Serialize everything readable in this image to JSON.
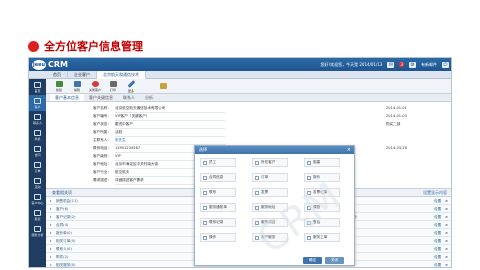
{
  "slide": {
    "title": "全方位客户信息管理"
  },
  "app": {
    "logo_badge": "Jeeu",
    "logo_text": "CRM",
    "top_right": {
      "welcome": "您好!欢迎您，今天是 2014/01/13",
      "badge": "3",
      "user_menu": "有新邮件"
    },
    "tabs": [
      {
        "label": "首页"
      },
      {
        "label": "企业客户"
      },
      {
        "label": "北京航天和通信技术"
      }
    ],
    "sidebar": [
      {
        "label": "首页"
      },
      {
        "label": "客户"
      },
      {
        "label": "联系人"
      },
      {
        "label": "商机"
      },
      {
        "label": "合同"
      },
      {
        "label": "订单"
      },
      {
        "label": "活动"
      },
      {
        "label": "客户中心"
      },
      {
        "label": "报表"
      },
      {
        "label": "服务分析"
      }
    ],
    "toolbar": [
      {
        "label": "新建",
        "color": "#4a8a3c"
      },
      {
        "label": "编辑",
        "color": "#3f74ab"
      },
      {
        "label": "关闭客户",
        "color": "#d23c3c"
      },
      {
        "label": "打印",
        "color": "#6a6a6a"
      },
      {
        "label": "更多",
        "color": "#3f74ab"
      },
      {
        "label": "",
        "color": "#caa23a"
      }
    ],
    "subtabs": [
      {
        "label": "客户基本信息"
      },
      {
        "label": "客户关键信息"
      },
      {
        "label": "联系人"
      },
      {
        "label": "分析"
      }
    ],
    "fields": [
      {
        "label": "客户名称：",
        "value": "北京航空航天通信技术有限公司"
      },
      {
        "label": "客户编号：",
        "value": "VIP客户（关键客户）"
      },
      {
        "label": "客户状态：",
        "value": "跟进中客户"
      },
      {
        "label": "客户所属：",
        "value": "活跃"
      },
      {
        "label": "主联系人：",
        "value": "张先生",
        "link": true
      },
      {
        "label": "联系电话：",
        "value": "13901234567"
      },
      {
        "label": "客户级别：",
        "value": "VIP"
      },
      {
        "label": "客户地址：",
        "value": "北京市海淀区中关村南大街"
      },
      {
        "label": "客户行业：",
        "value": "航空航天"
      },
      {
        "label": "需求描述：",
        "value": "详细描述客户需求"
      }
    ],
    "right_values": [
      "2014-01-01",
      "2014-01-03",
      "购买二部",
      "",
      "",
      "2014-03-28"
    ],
    "related": {
      "header": "查看相关项",
      "header_right": "设置显示内容",
      "rows": [
        {
          "label": "销售机会(11)",
          "actions": ""
        },
        {
          "label": "客户(6)",
          "actions": ""
        },
        {
          "label": "客户记录(2)",
          "actions": "新建一般活动  新建电话活动  新建邮件  新建会议活动"
        },
        {
          "label": "合同(4)",
          "actions": ""
        },
        {
          "label": "报价单(0)",
          "actions": ""
        },
        {
          "label": "相关订单(0)",
          "actions": ""
        },
        {
          "label": "联系人(0)",
          "actions": ""
        },
        {
          "label": "附件(2)",
          "actions": ""
        },
        {
          "label": "相关服务(0)",
          "actions": ""
        }
      ],
      "set_label": "设置",
      "close_label": "×"
    },
    "dialog": {
      "title": "选择",
      "close": "×",
      "options": [
        "员工",
        "所在客户",
        "阻塞",
        "合同信息",
        "订单",
        "报价",
        "联系",
        "发票",
        "发票记录",
        "服务通知单",
        "服务地址",
        "调查",
        "联系记录",
        "服务调查",
        "售后",
        "操作",
        "客户服务",
        "服务工单"
      ],
      "ok": "确定",
      "cancel": "关闭"
    }
  }
}
